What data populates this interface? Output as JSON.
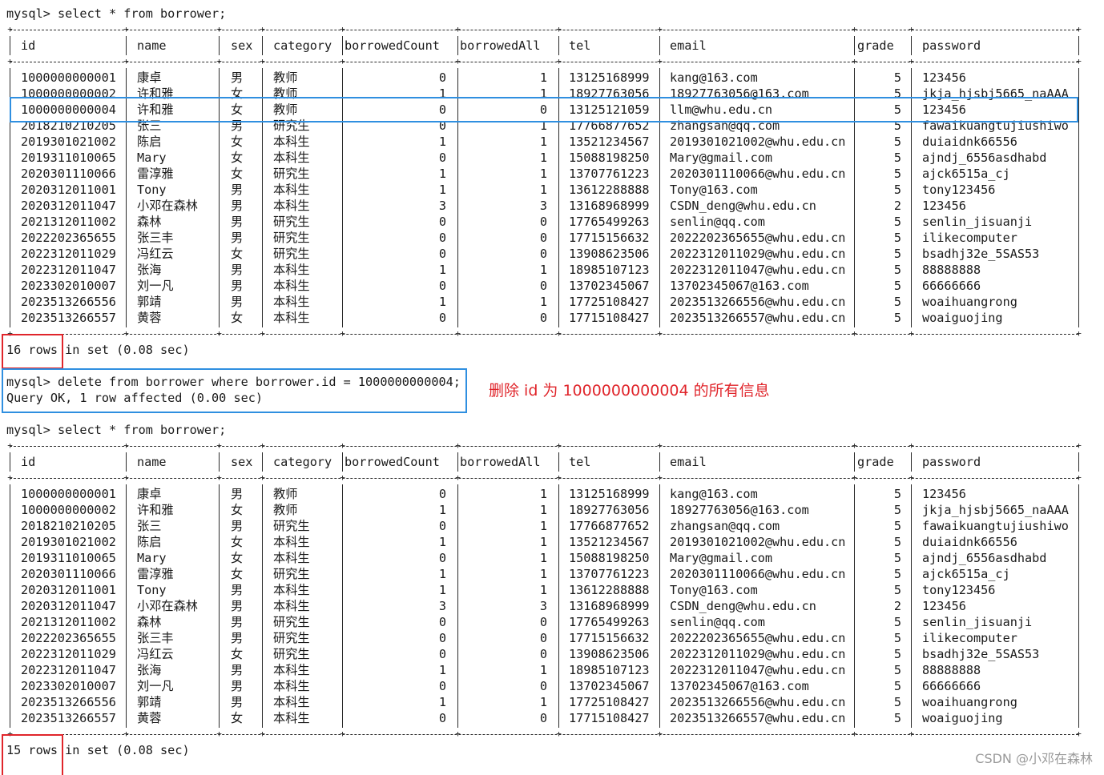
{
  "terminal": {
    "prompt_1": "mysql> select * from borrower;",
    "prompt_2": "mysql> delete from borrower where borrower.id = 1000000000004;",
    "result_2": "Query OK, 1 row affected (0.00 sec)",
    "prompt_3": "mysql> select * from borrower;"
  },
  "columns": [
    "id",
    "name",
    "sex",
    "category",
    "borrowedCount",
    "borrowedAll",
    "tel",
    "email",
    "grade",
    "password"
  ],
  "table_before": {
    "rows": [
      [
        "1000000000001",
        "康卓",
        "男",
        "教师",
        "0",
        "1",
        "13125168999",
        "kang@163.com",
        "5",
        "123456"
      ],
      [
        "1000000000002",
        "许和雅",
        "女",
        "教师",
        "1",
        "1",
        "18927763056",
        "18927763056@163.com",
        "5",
        "jkja_hjsbj5665_naAAA"
      ],
      [
        "1000000000004",
        "许和雅",
        "女",
        "教师",
        "0",
        "0",
        "13125121059",
        "llm@whu.edu.cn",
        "5",
        "123456"
      ],
      [
        "2018210210205",
        "张三",
        "男",
        "研究生",
        "0",
        "1",
        "17766877652",
        "zhangsan@qq.com",
        "5",
        "fawaikuangtujiushiwo"
      ],
      [
        "2019301021002",
        "陈启",
        "女",
        "本科生",
        "1",
        "1",
        "13521234567",
        "2019301021002@whu.edu.cn",
        "5",
        "duiaidnk66556"
      ],
      [
        "2019311010065",
        "Mary",
        "女",
        "本科生",
        "0",
        "1",
        "15088198250",
        "Mary@gmail.com",
        "5",
        "ajndj_6556asdhabd"
      ],
      [
        "2020301110066",
        "雷淳雅",
        "女",
        "研究生",
        "1",
        "1",
        "13707761223",
        "2020301110066@whu.edu.cn",
        "5",
        "ajck6515a_cj"
      ],
      [
        "2020312011001",
        "Tony",
        "男",
        "本科生",
        "1",
        "1",
        "13612288888",
        "Tony@163.com",
        "5",
        "tony123456"
      ],
      [
        "2020312011047",
        "小邓在森林",
        "男",
        "本科生",
        "3",
        "3",
        "13168968999",
        "CSDN_deng@whu.edu.cn",
        "2",
        "123456"
      ],
      [
        "2021312011002",
        "森林",
        "男",
        "研究生",
        "0",
        "0",
        "17765499263",
        "senlin@qq.com",
        "5",
        "senlin_jisuanji"
      ],
      [
        "2022202365655",
        "张三丰",
        "男",
        "研究生",
        "0",
        "0",
        "17715156632",
        "2022202365655@whu.edu.cn",
        "5",
        "ilikecomputer"
      ],
      [
        "2022312011029",
        "冯红云",
        "女",
        "研究生",
        "0",
        "0",
        "13908623506",
        "2022312011029@whu.edu.cn",
        "5",
        "bsadhj32e_5SAS53"
      ],
      [
        "2022312011047",
        "张海",
        "男",
        "本科生",
        "1",
        "1",
        "18985107123",
        "2022312011047@whu.edu.cn",
        "5",
        "88888888"
      ],
      [
        "2023302010007",
        "刘一凡",
        "男",
        "本科生",
        "0",
        "0",
        "13702345067",
        "13702345067@163.com",
        "5",
        "66666666"
      ],
      [
        "2023513266556",
        "郭靖",
        "男",
        "本科生",
        "1",
        "1",
        "17725108427",
        "2023513266556@whu.edu.cn",
        "5",
        "woaihuangrong"
      ],
      [
        "2023513266557",
        "黄蓉",
        "女",
        "本科生",
        "0",
        "0",
        "17715108427",
        "2023513266557@whu.edu.cn",
        "5",
        "woaiguojing"
      ]
    ],
    "count_label": "16 rows",
    "footer_rest": " in set (0.08 sec)"
  },
  "table_after": {
    "rows": [
      [
        "1000000000001",
        "康卓",
        "男",
        "教师",
        "0",
        "1",
        "13125168999",
        "kang@163.com",
        "5",
        "123456"
      ],
      [
        "1000000000002",
        "许和雅",
        "女",
        "教师",
        "1",
        "1",
        "18927763056",
        "18927763056@163.com",
        "5",
        "jkja_hjsbj5665_naAAA"
      ],
      [
        "2018210210205",
        "张三",
        "男",
        "研究生",
        "0",
        "1",
        "17766877652",
        "zhangsan@qq.com",
        "5",
        "fawaikuangtujiushiwo"
      ],
      [
        "2019301021002",
        "陈启",
        "女",
        "本科生",
        "1",
        "1",
        "13521234567",
        "2019301021002@whu.edu.cn",
        "5",
        "duiaidnk66556"
      ],
      [
        "2019311010065",
        "Mary",
        "女",
        "本科生",
        "0",
        "1",
        "15088198250",
        "Mary@gmail.com",
        "5",
        "ajndj_6556asdhabd"
      ],
      [
        "2020301110066",
        "雷淳雅",
        "女",
        "研究生",
        "1",
        "1",
        "13707761223",
        "2020301110066@whu.edu.cn",
        "5",
        "ajck6515a_cj"
      ],
      [
        "2020312011001",
        "Tony",
        "男",
        "本科生",
        "1",
        "1",
        "13612288888",
        "Tony@163.com",
        "5",
        "tony123456"
      ],
      [
        "2020312011047",
        "小邓在森林",
        "男",
        "本科生",
        "3",
        "3",
        "13168968999",
        "CSDN_deng@whu.edu.cn",
        "2",
        "123456"
      ],
      [
        "2021312011002",
        "森林",
        "男",
        "研究生",
        "0",
        "0",
        "17765499263",
        "senlin@qq.com",
        "5",
        "senlin_jisuanji"
      ],
      [
        "2022202365655",
        "张三丰",
        "男",
        "研究生",
        "0",
        "0",
        "17715156632",
        "2022202365655@whu.edu.cn",
        "5",
        "ilikecomputer"
      ],
      [
        "2022312011029",
        "冯红云",
        "女",
        "研究生",
        "0",
        "0",
        "13908623506",
        "2022312011029@whu.edu.cn",
        "5",
        "bsadhj32e_5SAS53"
      ],
      [
        "2022312011047",
        "张海",
        "男",
        "本科生",
        "1",
        "1",
        "18985107123",
        "2022312011047@whu.edu.cn",
        "5",
        "88888888"
      ],
      [
        "2023302010007",
        "刘一凡",
        "男",
        "本科生",
        "0",
        "0",
        "13702345067",
        "13702345067@163.com",
        "5",
        "66666666"
      ],
      [
        "2023513266556",
        "郭靖",
        "男",
        "本科生",
        "1",
        "1",
        "17725108427",
        "2023513266556@whu.edu.cn",
        "5",
        "woaihuangrong"
      ],
      [
        "2023513266557",
        "黄蓉",
        "女",
        "本科生",
        "0",
        "0",
        "17715108427",
        "2023513266557@whu.edu.cn",
        "5",
        "woaiguojing"
      ]
    ],
    "count_label": "15 rows",
    "footer_rest": " in set (0.08 sec)"
  },
  "annotation": "删除 id 为 1000000000004 的所有信息",
  "watermark": "CSDN @小邓在森林",
  "colors": {
    "highlight_red": "#e0252b",
    "highlight_blue": "#2f8fe0",
    "text": "#1a1a1a",
    "watermark": "#9a9a9a"
  }
}
